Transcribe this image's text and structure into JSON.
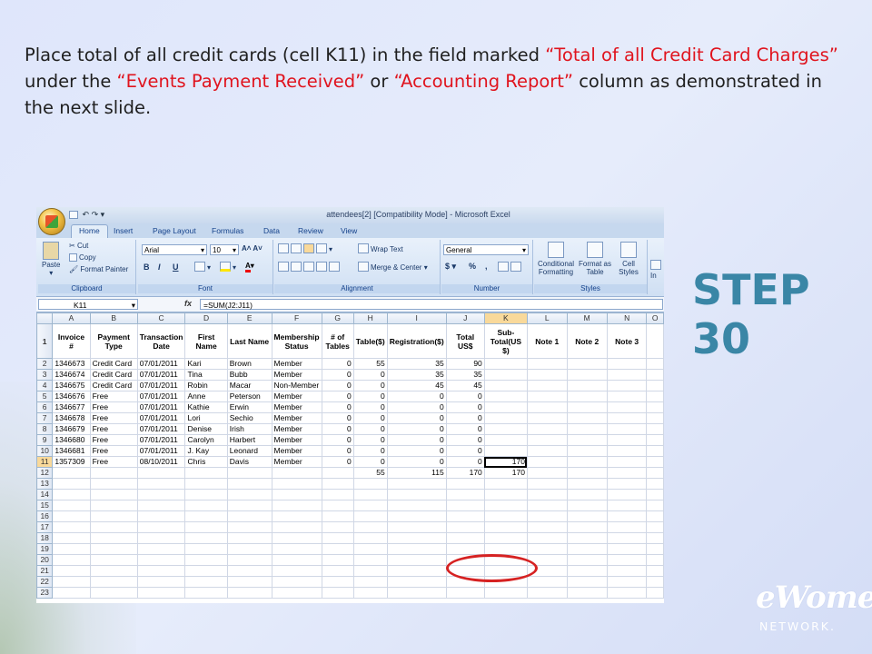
{
  "instruction": {
    "part1": "Place total of all credit cards (cell K11) in the field marked ",
    "quote1": "“Total of all Credit Card Charges”",
    "part2": " under the ",
    "quote2": "“Events Payment Received”",
    "part3": " or ",
    "quote3": "“Accounting Report”",
    "part4": " column as demonstrated in the next slide."
  },
  "step_label": "STEP 30",
  "logo": {
    "script": "eWomen",
    "sub": "NETWORK."
  },
  "colors": {
    "accent_teal": "#3a86a6",
    "highlight_red": "#e0141e"
  },
  "excel": {
    "title": "attendees[2]  [Compatibility Mode]  -  Microsoft Excel",
    "tabs": [
      "Home",
      "Insert",
      "Page Layout",
      "Formulas",
      "Data",
      "Review",
      "View"
    ],
    "clipboard": {
      "paste": "Paste",
      "cut": "Cut",
      "copy": "Copy",
      "format_painter": "Format Painter",
      "label": "Clipboard"
    },
    "font": {
      "name": "Arial",
      "size": "10",
      "bold": "B",
      "italic": "I",
      "underline": "U",
      "label": "Font"
    },
    "alignment": {
      "wrap": "Wrap Text",
      "merge": "Merge & Center",
      "label": "Alignment"
    },
    "number": {
      "format": "General",
      "currency": "$",
      "percent": "%",
      "comma": ",",
      "label": "Number"
    },
    "styles": {
      "conditional": "Conditional Formatting",
      "format_table": "Format as Table",
      "cell_styles": "Cell Styles",
      "label": "Styles"
    },
    "insert_partial": "In",
    "name_box": "K11",
    "fx": "fx",
    "formula": "=SUM(J2:J11)",
    "columns": [
      "A",
      "B",
      "C",
      "D",
      "E",
      "F",
      "G",
      "H",
      "I",
      "J",
      "K",
      "L",
      "M",
      "N",
      "O"
    ],
    "headers": [
      "Invoice #",
      "Payment Type",
      "Transaction Date",
      "First Name",
      "Last Name",
      "Membership Status",
      "# of Tables",
      "Table($)",
      "Registration($)",
      "Total US$",
      "Sub-Total(US $)",
      "Note 1",
      "Note 2",
      "Note 3",
      ""
    ],
    "rows": [
      [
        "1346673",
        "Credit Card",
        "07/01/2011",
        "Kari",
        "Brown",
        "Member",
        "0",
        "55",
        "35",
        "90",
        "",
        "",
        "",
        "",
        ""
      ],
      [
        "1346674",
        "Credit Card",
        "07/01/2011",
        "Tina",
        "Bubb",
        "Member",
        "0",
        "0",
        "35",
        "35",
        "",
        "",
        "",
        "",
        ""
      ],
      [
        "1346675",
        "Credit Card",
        "07/01/2011",
        "Robin",
        "Macar",
        "Non-Member",
        "0",
        "0",
        "45",
        "45",
        "",
        "",
        "",
        "",
        ""
      ],
      [
        "1346676",
        "Free",
        "07/01/2011",
        "Anne",
        "Peterson",
        "Member",
        "0",
        "0",
        "0",
        "0",
        "",
        "",
        "",
        "",
        ""
      ],
      [
        "1346677",
        "Free",
        "07/01/2011",
        "Kathie",
        "Erwin",
        "Member",
        "0",
        "0",
        "0",
        "0",
        "",
        "",
        "",
        "",
        ""
      ],
      [
        "1346678",
        "Free",
        "07/01/2011",
        "Lori",
        "Sechio",
        "Member",
        "0",
        "0",
        "0",
        "0",
        "",
        "",
        "",
        "",
        ""
      ],
      [
        "1346679",
        "Free",
        "07/01/2011",
        "Denise",
        "Irish",
        "Member",
        "0",
        "0",
        "0",
        "0",
        "",
        "",
        "",
        "",
        ""
      ],
      [
        "1346680",
        "Free",
        "07/01/2011",
        "Carolyn",
        "Harbert",
        "Member",
        "0",
        "0",
        "0",
        "0",
        "",
        "",
        "",
        "",
        ""
      ],
      [
        "1346681",
        "Free",
        "07/01/2011",
        "J. Kay",
        "Leonard",
        "Member",
        "0",
        "0",
        "0",
        "0",
        "",
        "",
        "",
        "",
        ""
      ],
      [
        "1357309",
        "Free",
        "08/10/2011",
        "Chris",
        "Davis",
        "Member",
        "0",
        "0",
        "0",
        "0",
        "170",
        "",
        "",
        "",
        ""
      ],
      [
        "",
        "",
        "",
        "",
        "",
        "",
        "",
        "55",
        "115",
        "170",
        "170",
        "",
        "",
        "",
        ""
      ]
    ],
    "row_numbers": [
      "1",
      "2",
      "3",
      "4",
      "5",
      "6",
      "7",
      "8",
      "9",
      "10",
      "11",
      "12",
      "13",
      "14",
      "15",
      "16",
      "17",
      "18",
      "19",
      "20",
      "21",
      "22",
      "23"
    ]
  }
}
